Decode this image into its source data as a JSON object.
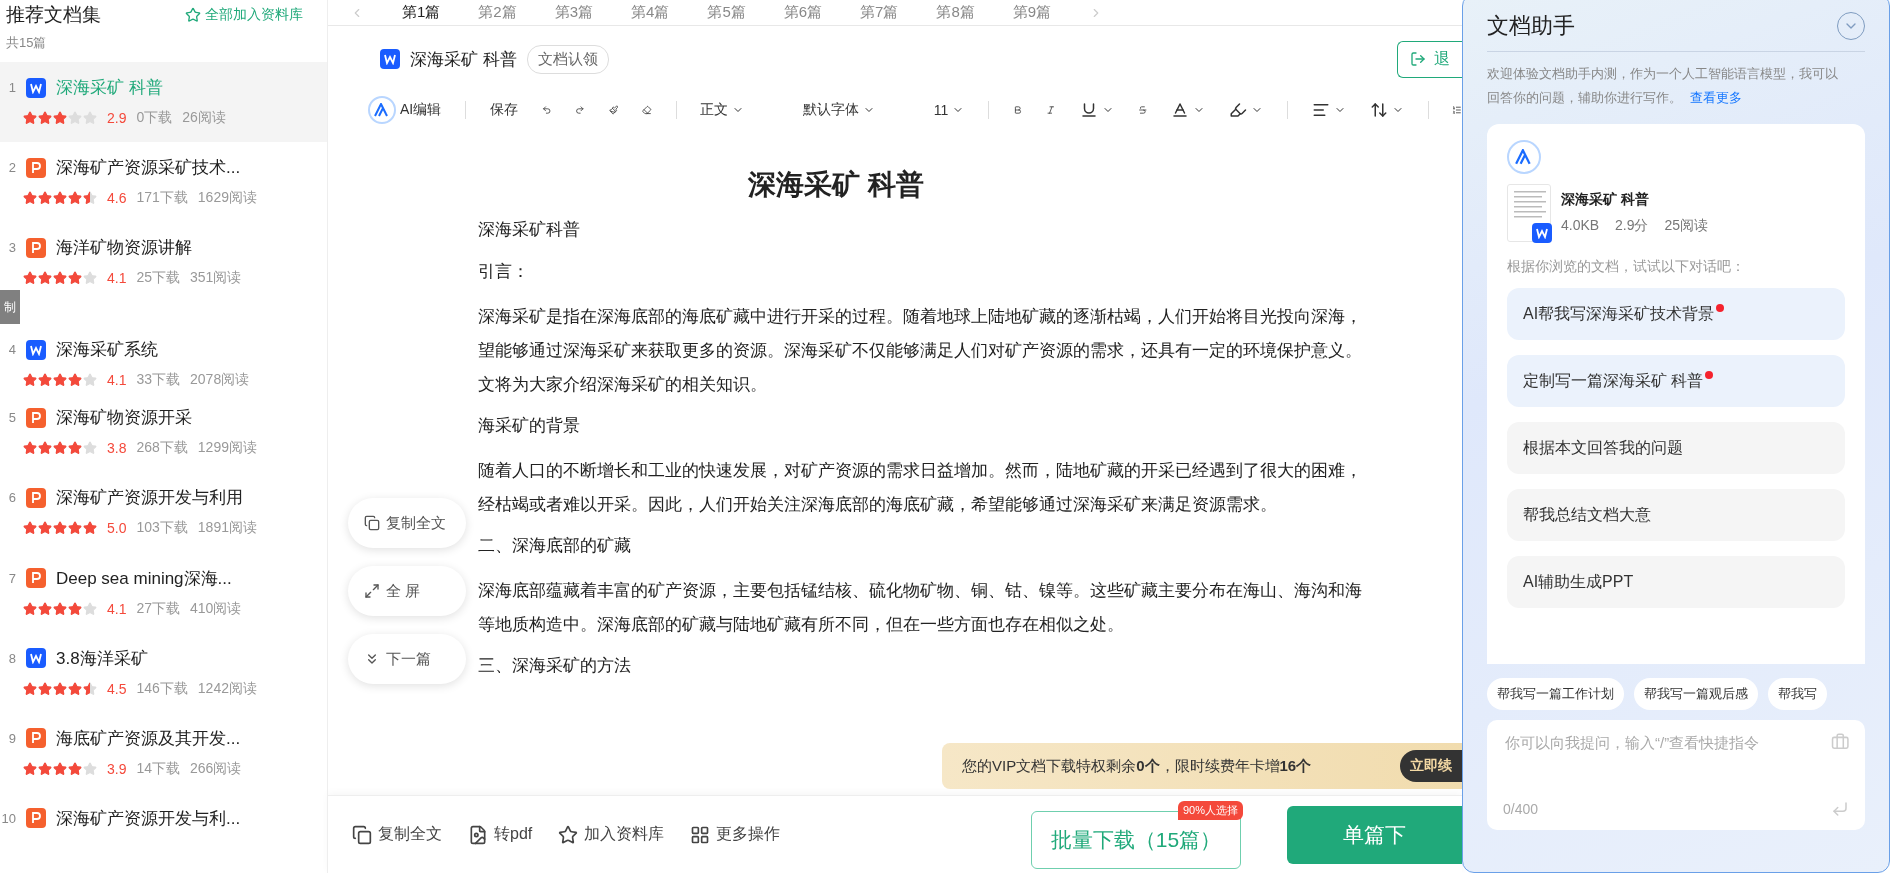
{
  "tabs": [
    {
      "label": "第1篇",
      "selected": true
    },
    {
      "label": "第2篇",
      "selected": false
    },
    {
      "label": "第3篇",
      "selected": false
    },
    {
      "label": "第4篇",
      "selected": false
    },
    {
      "label": "第5篇",
      "selected": false
    },
    {
      "label": "第6篇",
      "selected": false
    },
    {
      "label": "第7篇",
      "selected": false
    },
    {
      "label": "第8篇",
      "selected": false
    },
    {
      "label": "第9篇",
      "selected": false
    }
  ],
  "sidebar": {
    "title": "推荐文档集",
    "add_all": "全部加入资料库",
    "count": "共15篇",
    "items": [
      {
        "index": "1",
        "kind": "word",
        "title": "深海采矿 科普",
        "stars": 3,
        "rating": "2.9",
        "downloads": "0下载",
        "reads": "26阅读",
        "selected": true
      },
      {
        "index": "2",
        "kind": "ppt",
        "title": "深海矿产资源采矿技术...",
        "stars": 4.5,
        "rating": "4.6",
        "downloads": "171下载",
        "reads": "1629阅读",
        "selected": false
      },
      {
        "index": "3",
        "kind": "ppt",
        "title": "海洋矿物资源讲解",
        "stars": 4,
        "rating": "4.1",
        "downloads": "25下载",
        "reads": "351阅读",
        "selected": false
      },
      {
        "index": "4",
        "kind": "word",
        "title": "深海采矿系统",
        "stars": 4,
        "rating": "4.1",
        "downloads": "33下载",
        "reads": "2078阅读",
        "selected": false
      },
      {
        "index": "5",
        "kind": "ppt",
        "title": "深海矿物资源开采",
        "stars": 4,
        "rating": "3.8",
        "downloads": "268下载",
        "reads": "1299阅读",
        "selected": false
      },
      {
        "index": "6",
        "kind": "ppt",
        "title": "深海矿产资源开发与利用",
        "stars": 5,
        "rating": "5.0",
        "downloads": "103下载",
        "reads": "1891阅读",
        "selected": false
      },
      {
        "index": "7",
        "kind": "ppt",
        "title": "Deep sea mining深海...",
        "stars": 4,
        "rating": "4.1",
        "downloads": "27下载",
        "reads": "410阅读",
        "selected": false
      },
      {
        "index": "8",
        "kind": "word",
        "title": "3.8海洋采矿",
        "stars": 4.5,
        "rating": "4.5",
        "downloads": "146下载",
        "reads": "1242阅读",
        "selected": false
      },
      {
        "index": "9",
        "kind": "ppt",
        "title": "海底矿产资源及其开发...",
        "stars": 4,
        "rating": "3.9",
        "downloads": "14下载",
        "reads": "266阅读",
        "selected": false
      },
      {
        "index": "10",
        "kind": "ppt",
        "title": "深海矿产资源开发与利...",
        "selected": false
      }
    ]
  },
  "copy_tooltip": "制",
  "document": {
    "kind": "word",
    "title": "深海采矿 科普",
    "claim": "文档认领",
    "exit": "退"
  },
  "toolbar": {
    "ai_edit": "AI编辑",
    "save": "保存",
    "style": "正文",
    "font": "默认字体",
    "size": "11"
  },
  "content": {
    "heading": "深海采矿 科普",
    "blocks": [
      {
        "kind": "line",
        "lines": [
          "深海采矿科普"
        ]
      },
      {
        "kind": "line",
        "lines": [
          "引言："
        ]
      },
      {
        "kind": "para",
        "lines": [
          "深海采矿是指在深海底部的海底矿藏中进行开采的过程。随着地球上陆地矿藏的逐渐枯竭，人们开始将目光投向深海，",
          "望能够通过深海采矿来获取更多的资源。深海采矿不仅能够满足人们对矿产资源的需求，还具有一定的环境保护意义。",
          "文将为大家介绍深海采矿的相关知识。"
        ]
      },
      {
        "kind": "line",
        "lines": [
          "海采矿的背景"
        ]
      },
      {
        "kind": "para",
        "lines": [
          "随着人口的不断增长和工业的快速发展，对矿产资源的需求日益增加。然而，陆地矿藏的开采已经遇到了很大的困难，",
          "经枯竭或者难以开采。因此，人们开始关注深海底部的海底矿藏，希望能够通过深海采矿来满足资源需求。"
        ]
      },
      {
        "kind": "line",
        "lines": [
          "二、深海底部的矿藏"
        ]
      },
      {
        "kind": "para",
        "lines": [
          "深海底部蕴藏着丰富的矿产资源，主要包括锰结核、硫化物矿物、铜、钴、镍等。这些矿藏主要分布在海山、海沟和海",
          "等地质构造中。深海底部的矿藏与陆地矿藏有所不同，但在一些方面也存在相似之处。"
        ]
      },
      {
        "kind": "line",
        "lines": [
          "三、深海采矿的方法"
        ]
      }
    ]
  },
  "floating_actions": [
    "复制全文",
    "全 屏",
    "下一篇"
  ],
  "vip": {
    "text": "您的VIP文档下载特权剩余**0个**，限时续费年卡增**16个**",
    "button": "立即续"
  },
  "bottom_bar": {
    "actions": [
      "复制全文",
      "转pdf",
      "加入资料库",
      "更多操作"
    ],
    "batch": "批量下载（15篇）",
    "badge": "90%人选择",
    "single": "单篇下"
  },
  "assistant": {
    "title": "文档助手",
    "intro": "欢迎体验文档助手内测，作为一个人工智能语言模型，我可以回答你的问题，辅助你进行写作。",
    "link": "查看更多",
    "doc": {
      "title": "深海采矿 科普",
      "size": "4.0KB",
      "score": "2.9分",
      "reads": "25阅读"
    },
    "prompt": "根据你浏览的文档，试试以下对话吧：",
    "suggestions": [
      {
        "label": "AI帮我写深海采矿技术背景",
        "new": true
      },
      {
        "label": "定制写一篇深海采矿 科普",
        "new": true
      },
      {
        "label": "根据本文回答我的问题",
        "new": false
      },
      {
        "label": "帮我总结文档大意",
        "new": false
      },
      {
        "label": "AI辅助生成PPT",
        "new": false
      }
    ],
    "chips": [
      "帮我写一篇工作计划",
      "帮我写一篇观后感",
      "帮我写"
    ],
    "input": {
      "placeholder": "你可以向我提问，输入“/”查看快捷指令",
      "counter": "0/400"
    }
  }
}
